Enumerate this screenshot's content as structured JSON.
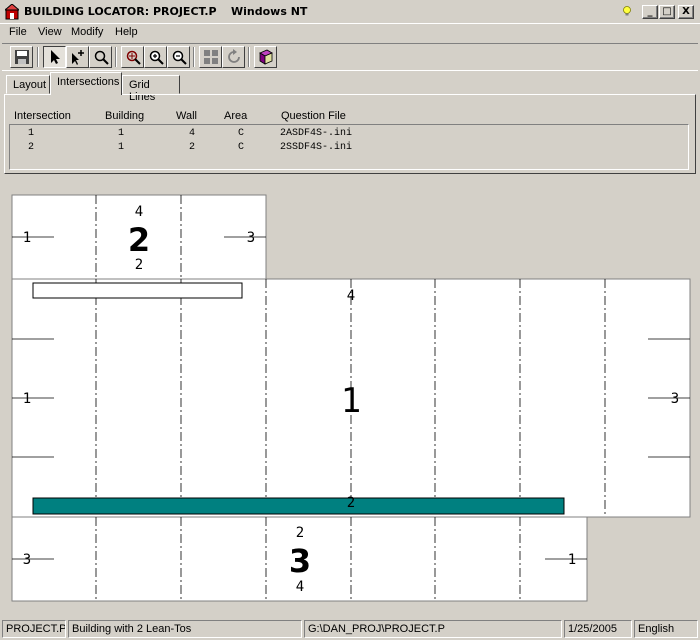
{
  "window": {
    "title": "BUILDING LOCATOR: PROJECT.P",
    "os_label": "Windows NT",
    "minimize_glyph": "_",
    "maximize_glyph": "□",
    "close_glyph": "X"
  },
  "menu": [
    {
      "label": "File"
    },
    {
      "label": "View"
    },
    {
      "label": "Modify"
    },
    {
      "label": "Help"
    }
  ],
  "toolbar": {
    "buttons": [
      {
        "icon": "save-icon"
      },
      {
        "icon": "pointer-icon",
        "pressed": true
      },
      {
        "icon": "add-pointer-icon"
      },
      {
        "icon": "magnify-icon"
      },
      {
        "icon": "zoom-fit-icon"
      },
      {
        "icon": "zoom-in-icon"
      },
      {
        "icon": "zoom-out-icon"
      },
      {
        "icon": "grid-icon"
      },
      {
        "icon": "rotate-icon"
      },
      {
        "icon": "book-icon"
      }
    ]
  },
  "tabs": [
    {
      "label": "Layout"
    },
    {
      "label": "Intersections",
      "active": true
    },
    {
      "label": "Grid Lines"
    }
  ],
  "intersections": {
    "columns": [
      "Intersection",
      "Building",
      "Wall",
      "Area",
      "Question File"
    ],
    "rows": [
      [
        "1",
        "1",
        "4",
        "C",
        "2ASDF4S-.ini"
      ],
      [
        "2",
        "1",
        "2",
        "C",
        "2SSDF4S-.ini"
      ]
    ]
  },
  "drawing": {
    "colors": {
      "background": "#d4d0c8",
      "building_fill": "#ffffff",
      "lean_to_bar": "#008080",
      "grid_line": "#000000"
    },
    "buildings": [
      {
        "number": "2",
        "walls": {
          "top": "4",
          "bottom": "2",
          "left": "1",
          "right": "3"
        }
      },
      {
        "number": "1",
        "walls": {
          "top": "4",
          "bottom": "2",
          "left": "1",
          "right": "3"
        }
      },
      {
        "number": "3",
        "walls": {
          "top": "2",
          "bottom": "4",
          "left": "3",
          "right": "1"
        }
      }
    ]
  },
  "status": {
    "project": "PROJECT.P",
    "description": "Building with 2 Lean-Tos",
    "path": "G:\\DAN_PROJ\\PROJECT.P",
    "date": "1/25/2005",
    "language": "English"
  }
}
